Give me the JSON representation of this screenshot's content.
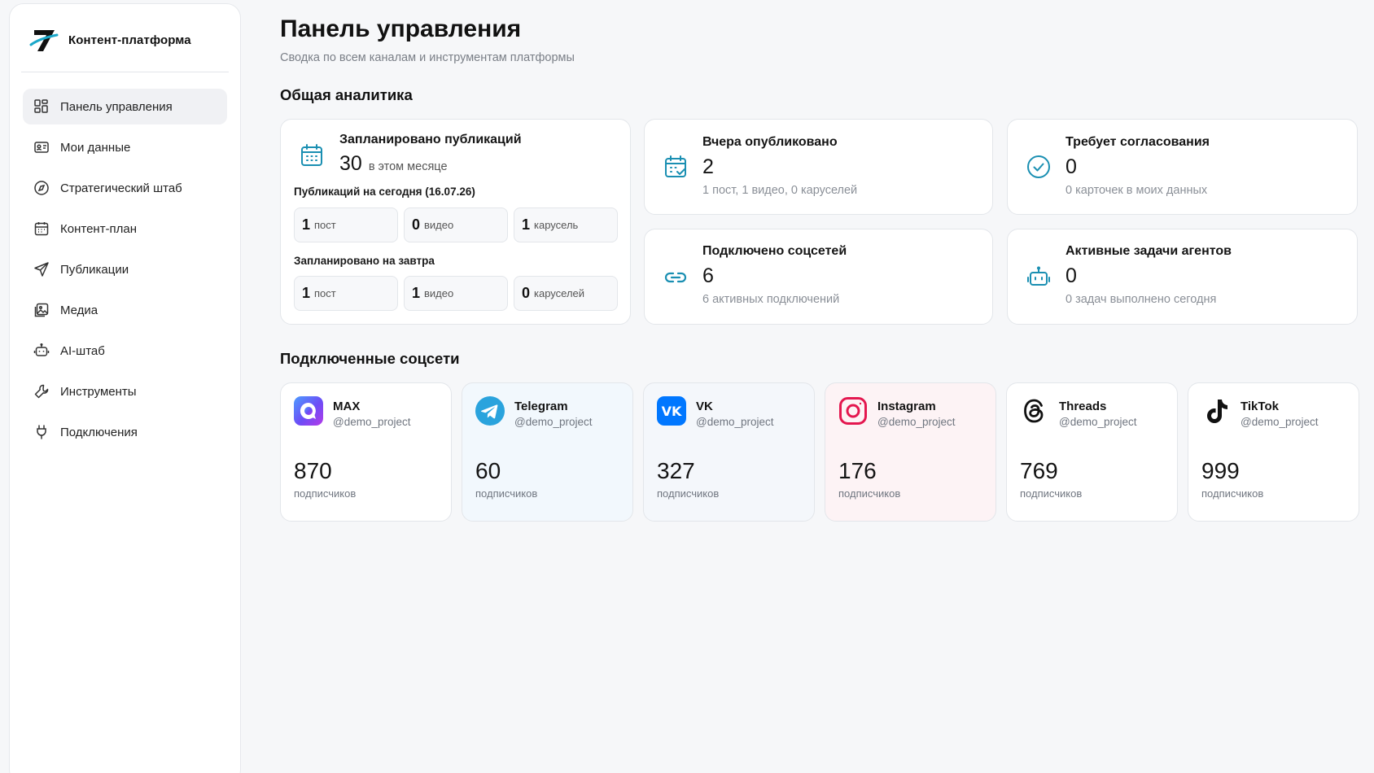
{
  "brand": {
    "name": "Контент-платформа",
    "logo": "7-logo"
  },
  "sidebar": {
    "items": [
      {
        "label": "Панель управления",
        "icon": "grid-icon",
        "active": true
      },
      {
        "label": "Мои данные",
        "icon": "id-card-icon"
      },
      {
        "label": "Стратегический штаб",
        "icon": "compass-icon"
      },
      {
        "label": "Контент-план",
        "icon": "calendar-icon"
      },
      {
        "label": "Публикации",
        "icon": "send-icon"
      },
      {
        "label": "Медиа",
        "icon": "image-icon"
      },
      {
        "label": "AI-штаб",
        "icon": "robot-icon"
      },
      {
        "label": "Инструменты",
        "icon": "wrench-icon"
      },
      {
        "label": "Подключения",
        "icon": "plug-icon"
      }
    ]
  },
  "header": {
    "title": "Панель управления",
    "subtitle": "Сводка по всем каналам и инструментам платформы"
  },
  "analytics": {
    "title": "Общая аналитика",
    "scheduled": {
      "label": "Запланировано публикаций",
      "value": "30",
      "value_suffix": "в этом месяце",
      "today_label": "Публикаций на сегодня (16.07.26)",
      "today": [
        {
          "num": "1",
          "unit": "пост"
        },
        {
          "num": "0",
          "unit": "видео"
        },
        {
          "num": "1",
          "unit": "карусель"
        }
      ],
      "tomorrow_label": "Запланировано на завтра",
      "tomorrow": [
        {
          "num": "1",
          "unit": "пост"
        },
        {
          "num": "1",
          "unit": "видео"
        },
        {
          "num": "0",
          "unit": "каруселей"
        }
      ]
    },
    "yesterday": {
      "label": "Вчера опубликовано",
      "value": "2",
      "note": "1 пост, 1 видео, 0 каруселей"
    },
    "approval": {
      "label": "Требует согласования",
      "value": "0",
      "note": "0 карточек в моих данных"
    },
    "connected": {
      "label": "Подключено соцсетей",
      "value": "6",
      "note": "6 активных подключений"
    },
    "agents": {
      "label": "Активные задачи агентов",
      "value": "0",
      "note": "0 задач выполнено сегодня"
    }
  },
  "socials": {
    "title": "Подключенные соцсети",
    "subscribers_label": "подписчиков",
    "items": [
      {
        "name": "MAX",
        "handle": "@demo_project",
        "count": "870",
        "icon": "max-icon",
        "bg": "#ffffff"
      },
      {
        "name": "Telegram",
        "handle": "@demo_project",
        "count": "60",
        "icon": "telegram-icon",
        "bg": "#f2f8fd"
      },
      {
        "name": "VK",
        "handle": "@demo_project",
        "count": "327",
        "icon": "vk-icon",
        "bg": "#f4f7fb"
      },
      {
        "name": "Instagram",
        "handle": "@demo_project",
        "count": "176",
        "icon": "instagram-icon",
        "bg": "#fdf3f5"
      },
      {
        "name": "Threads",
        "handle": "@demo_project",
        "count": "769",
        "icon": "threads-icon",
        "bg": "#ffffff"
      },
      {
        "name": "TikTok",
        "handle": "@demo_project",
        "count": "999",
        "icon": "tiktok-icon",
        "bg": "#ffffff"
      }
    ]
  },
  "colors": {
    "accent": "#1a8fb2",
    "nav_active_bg": "#f0f1f4"
  }
}
